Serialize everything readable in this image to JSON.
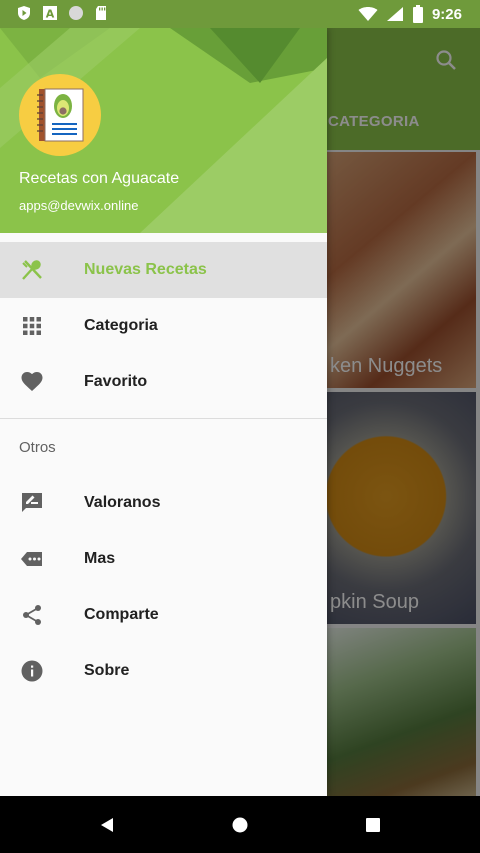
{
  "status_bar": {
    "time": "9:26",
    "left_icons": [
      "shield-icon",
      "font-a-icon",
      "circle-icon",
      "sd-card-icon"
    ],
    "right_icons": [
      "wifi-icon",
      "signal-icon",
      "battery-icon"
    ]
  },
  "background_app": {
    "tab_label": "CATEGORIA",
    "cards": [
      {
        "title": "Chicken Nuggets",
        "visible_title": "ken Nuggets"
      },
      {
        "title": "Pumpkin Soup",
        "visible_title": "pkin Soup"
      },
      {
        "title": ""
      }
    ]
  },
  "drawer": {
    "header": {
      "app_name": "Recetas con Aguacate",
      "email": "apps@devwix.online",
      "avatar_icon": "avocado-recipe-book-icon"
    },
    "items": [
      {
        "label": "Nuevas Recetas",
        "icon": "fork-spoon-icon",
        "active": true
      },
      {
        "label": "Categoria",
        "icon": "grid-icon",
        "active": false
      },
      {
        "label": "Favorito",
        "icon": "heart-icon",
        "active": false
      }
    ],
    "section_title": "Otros",
    "other_items": [
      {
        "label": "Valoranos",
        "icon": "rate-review-icon"
      },
      {
        "label": "Mas",
        "icon": "more-tag-icon"
      },
      {
        "label": "Comparte",
        "icon": "share-icon"
      },
      {
        "label": "Sobre",
        "icon": "info-icon"
      }
    ]
  },
  "colors": {
    "primary": "#8bc34a",
    "primary_dark": "#6f9a3b",
    "active_item_bg": "#e0e0e0",
    "icon_gray": "#616161"
  },
  "nav_bar": {
    "buttons": [
      "back-icon",
      "home-icon",
      "recents-icon"
    ]
  }
}
